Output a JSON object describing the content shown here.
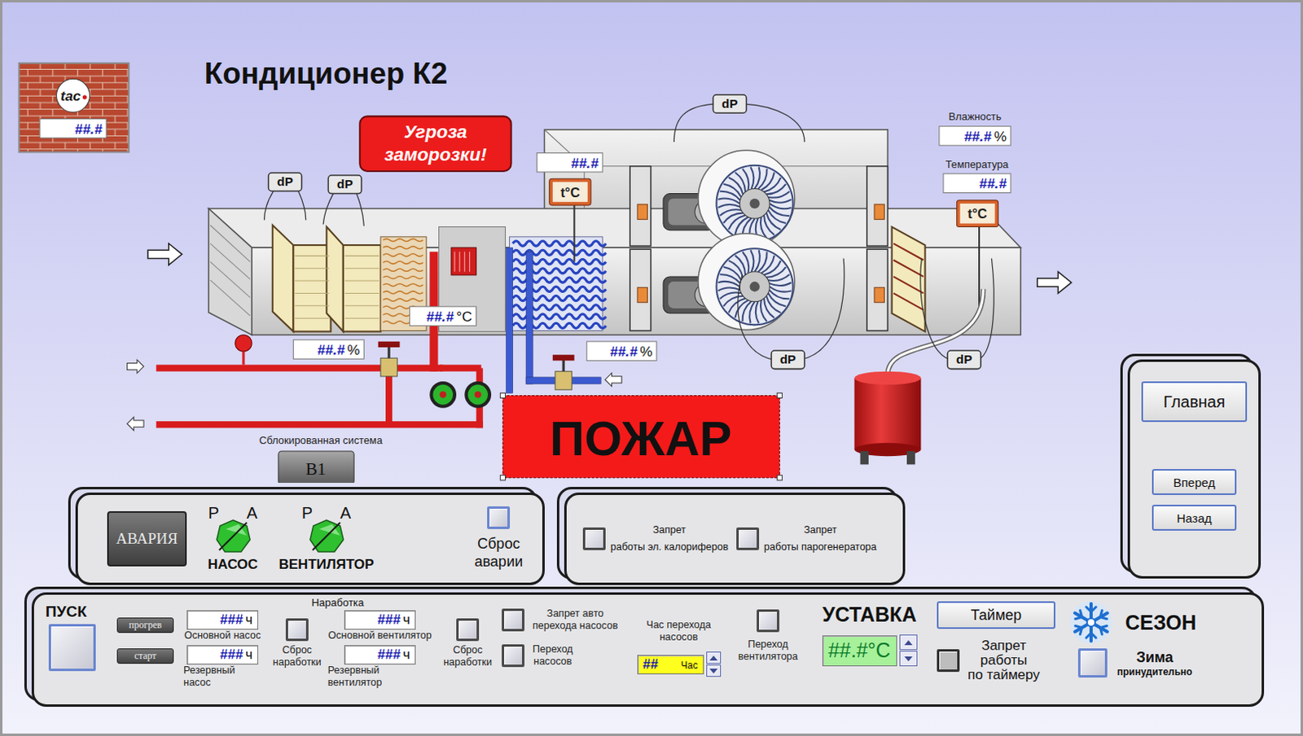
{
  "logo": {
    "text": "tac",
    "value": "##.#"
  },
  "title": "Кондиционер К2",
  "frost_alert": [
    "Угроза",
    "заморозки!"
  ],
  "fire_alert": "ПОЖАР",
  "diagram": {
    "dp_tags": [
      "dP",
      "dP",
      "dP",
      "dP",
      "dP"
    ],
    "temp_probes": [
      "t°C",
      "t°C"
    ],
    "readouts": [
      {
        "value": "##.#",
        "unit": "%"
      },
      {
        "value": "##.#",
        "unit": "°C"
      },
      {
        "value": "##.#",
        "unit": "%"
      },
      {
        "value": "##.#"
      },
      {
        "label": "Влажность",
        "value": "##.#",
        "unit": "%"
      },
      {
        "label": "Температура",
        "value": "##.#"
      }
    ],
    "pumps": [
      {
        "running": true
      },
      {
        "running": true
      }
    ]
  },
  "blocked_system": {
    "label": "Сблокированная система",
    "button": "B1"
  },
  "status_panel": {
    "alarm": "АВАРИЯ",
    "indicators": [
      {
        "name": "НАСОС",
        "left": "Р",
        "right": "А",
        "on": true
      },
      {
        "name": "ВЕНТИЛЯТОР",
        "left": "Р",
        "right": "А",
        "on": true
      }
    ],
    "reset": {
      "lines": [
        "Сброс",
        "аварии"
      ],
      "checked": false
    }
  },
  "prohibit_panel": [
    {
      "lines": [
        "Запрет",
        "работы эл. калориферов"
      ],
      "checked": false
    },
    {
      "lines": [
        "Запрет",
        "работы парогенератора"
      ],
      "checked": false
    }
  ],
  "controls": {
    "start": {
      "label": "ПУСК",
      "checked": false
    },
    "modes": [
      "прогрев",
      "старт"
    ],
    "runtime": {
      "title": "Наработка",
      "groups": [
        {
          "counters": [
            {
              "value": "###",
              "unit": "ч",
              "label": "Основной насос"
            },
            {
              "value": "###",
              "unit": "ч",
              "label": "Резервный насос"
            }
          ],
          "reset": {
            "lines": [
              "Сброс",
              "наработки"
            ],
            "checked": false
          }
        },
        {
          "counters": [
            {
              "value": "###",
              "unit": "ч",
              "label": "Основной вентилятор"
            },
            {
              "value": "###",
              "unit": "ч",
              "label": "Резервный вентилятор"
            }
          ],
          "reset": {
            "lines": [
              "Сброс",
              "наработки"
            ],
            "checked": false
          }
        }
      ]
    },
    "pump_switches": [
      {
        "lines": [
          "Запрет авто",
          "перехода насосов"
        ],
        "checked": false
      },
      {
        "lines": [
          "Переход",
          "насосов"
        ],
        "checked": false
      }
    ],
    "switch_hour": {
      "lines": [
        "Час перехода",
        "насосов"
      ],
      "value": "##",
      "unit": "Час"
    },
    "fan_switch": {
      "lines": [
        "Переход",
        "вентилятора"
      ],
      "checked": false
    },
    "setpoint": {
      "title": "УСТАВКА",
      "value": "##.#",
      "unit": "°C"
    },
    "timer": {
      "button": "Таймер",
      "lines": [
        "Запрет",
        "работы",
        "по таймеру"
      ],
      "checked": false
    },
    "season": {
      "title": "СЕЗОН",
      "mode": "Зима",
      "note": "принудительно",
      "checked": false
    }
  },
  "nav": [
    "Главная",
    "Вперед",
    "Назад"
  ]
}
